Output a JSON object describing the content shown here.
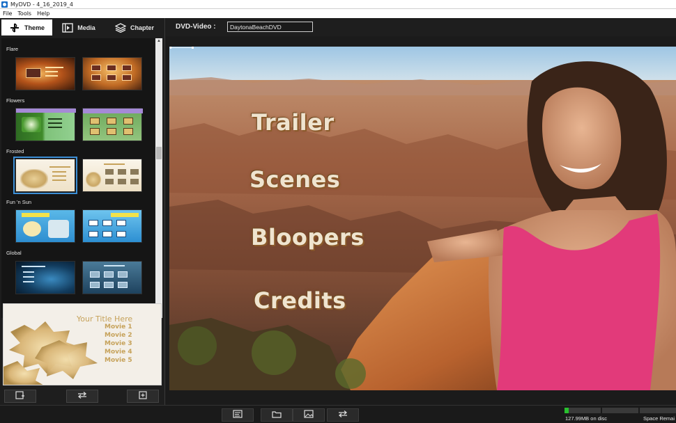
{
  "window": {
    "title": "MyDVD - 4_16_2019_4"
  },
  "menu": [
    "File",
    "Tools",
    "Help"
  ],
  "tabs": [
    {
      "label": "Theme",
      "icon": "theme-icon",
      "active": true
    },
    {
      "label": "Media",
      "icon": "film-icon",
      "active": false
    },
    {
      "label": "Chapter",
      "icon": "layers-icon",
      "active": false
    }
  ],
  "themes": [
    {
      "name": "Flare"
    },
    {
      "name": "Flowers"
    },
    {
      "name": "Frosted"
    },
    {
      "name": "Fun 'n Sun"
    },
    {
      "name": "Global"
    }
  ],
  "preview": {
    "title": "Your Title Here",
    "items": [
      "Movie 1",
      "Movie 2",
      "Movie 3",
      "Movie 4",
      "Movie 5"
    ]
  },
  "project": {
    "label": "DVD-Video :",
    "name": "DaytonaBeachDVD"
  },
  "dvd_menu": {
    "items": [
      "Trailer",
      "Scenes",
      "Bloopers",
      "Credits"
    ]
  },
  "status": {
    "disc_used": "127.99MB on disc",
    "space_remaining": "Space Remai",
    "fill_fraction": 0.04
  },
  "colors": {
    "accent": "#3c8fd6",
    "menu_text": "#efe4cf",
    "meter_fill": "#28c02e"
  }
}
